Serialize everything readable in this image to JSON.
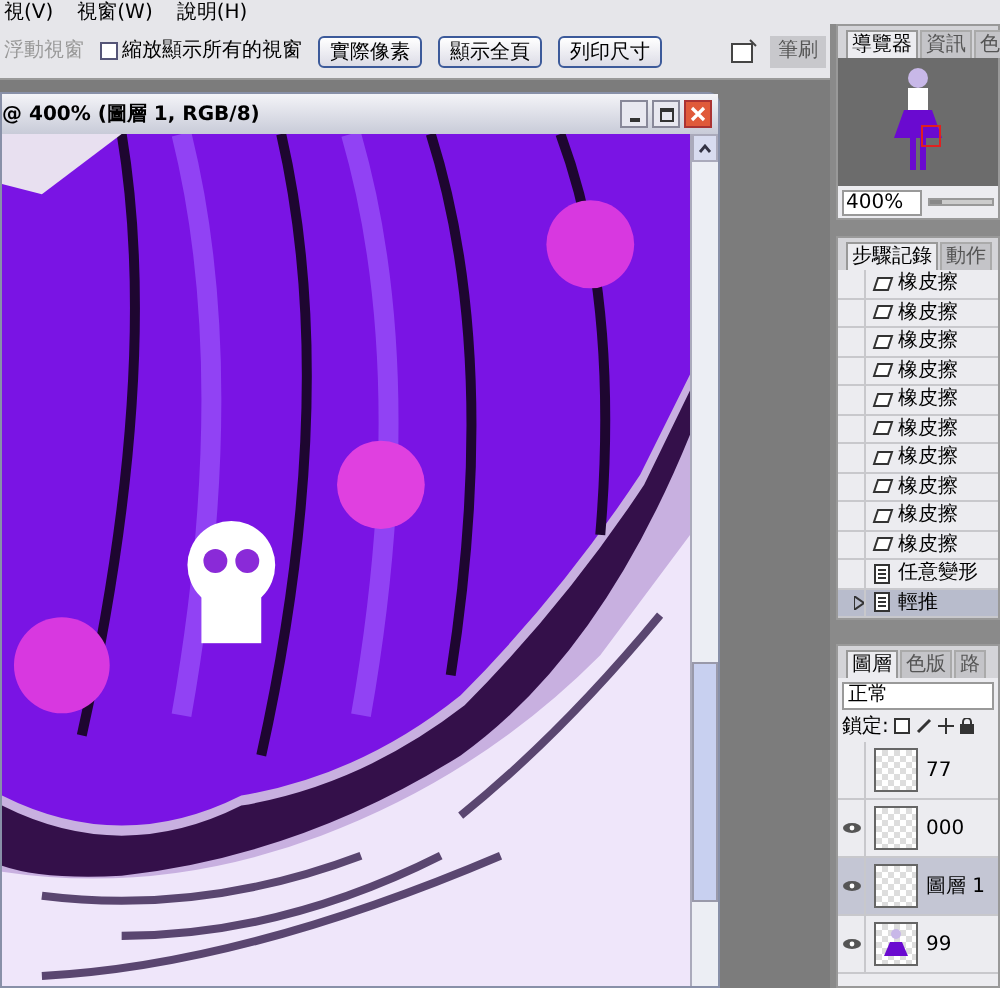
{
  "menu": [
    "視(V)",
    "視窗(W)",
    "說明(H)"
  ],
  "options_bar": {
    "float_label": "浮動視窗",
    "resize_checkbox": {
      "label": "縮放顯示所有的視窗",
      "checked": false
    },
    "buttons": [
      "實際像素",
      "顯示全頁",
      "列印尺寸"
    ],
    "dock_tab": "筆刷"
  },
  "document": {
    "title": "@ 400% (圖層 1, RGB/8)"
  },
  "navigator": {
    "tabs": [
      {
        "label": "導覽器",
        "selected": true
      },
      {
        "label": "資訊",
        "selected": false
      },
      {
        "label": "色",
        "selected": false
      }
    ],
    "zoom": "400%",
    "level": 0.2
  },
  "history": {
    "tabs": [
      {
        "label": "步驟記錄",
        "selected": true
      },
      {
        "label": "動作",
        "selected": false
      }
    ],
    "items": [
      {
        "label": "橡皮擦",
        "kind": "eraser",
        "selected": false
      },
      {
        "label": "橡皮擦",
        "kind": "eraser",
        "selected": false
      },
      {
        "label": "橡皮擦",
        "kind": "eraser",
        "selected": false
      },
      {
        "label": "橡皮擦",
        "kind": "eraser",
        "selected": false
      },
      {
        "label": "橡皮擦",
        "kind": "eraser",
        "selected": false
      },
      {
        "label": "橡皮擦",
        "kind": "eraser",
        "selected": false
      },
      {
        "label": "橡皮擦",
        "kind": "eraser",
        "selected": false
      },
      {
        "label": "橡皮擦",
        "kind": "eraser",
        "selected": false
      },
      {
        "label": "橡皮擦",
        "kind": "eraser",
        "selected": false
      },
      {
        "label": "橡皮擦",
        "kind": "eraser",
        "selected": false
      },
      {
        "label": "任意變形",
        "kind": "step",
        "selected": false
      },
      {
        "label": "輕推",
        "kind": "step",
        "selected": true
      }
    ]
  },
  "layers": {
    "tabs": [
      {
        "label": "圖層",
        "selected": true
      },
      {
        "label": "色版",
        "selected": false
      },
      {
        "label": "路",
        "selected": false
      }
    ],
    "blend_mode": "正常",
    "lock_label": "鎖定:",
    "items": [
      {
        "name": "77",
        "visible": false,
        "selected": false,
        "kind": "empty"
      },
      {
        "name": "000",
        "visible": true,
        "selected": false,
        "kind": "empty"
      },
      {
        "name": "圖層 1",
        "visible": true,
        "selected": true,
        "kind": "empty"
      },
      {
        "name": "99",
        "visible": true,
        "selected": false,
        "kind": "figure"
      }
    ]
  }
}
